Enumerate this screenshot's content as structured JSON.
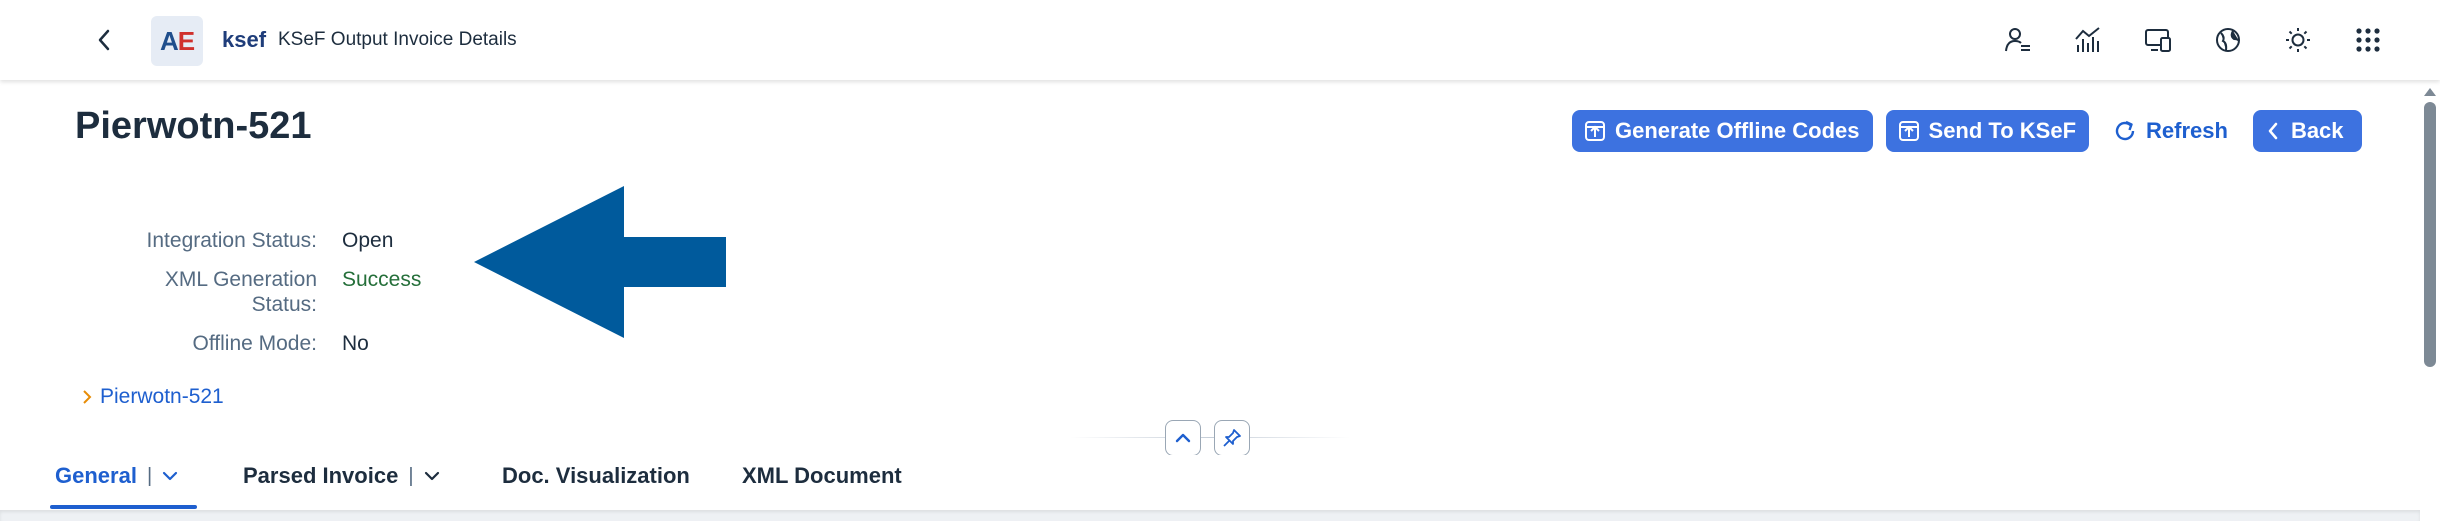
{
  "shell": {
    "logo_a": "A",
    "logo_e": "E",
    "app_name": "ksef",
    "title": "KSeF Output Invoice Details",
    "icons": [
      "user-menu-icon",
      "analytics-icon",
      "device-icon",
      "globe-icon",
      "theme-icon",
      "app-grid-icon"
    ]
  },
  "header": {
    "title": "Pierwotn-521",
    "actions": {
      "generate_offline_codes": "Generate Offline Codes",
      "send_to_ksef": "Send To KSeF",
      "refresh": "Refresh",
      "back": "Back"
    },
    "fields": [
      {
        "label": "Integration Status:",
        "value": "Open"
      },
      {
        "label_line1": "XML Generation",
        "label_line2": "Status:",
        "value": "Success"
      },
      {
        "label": "Offline Mode:",
        "value": "No"
      }
    ],
    "link": "Pierwotn-521"
  },
  "tabs": [
    {
      "label": "General",
      "selected": true,
      "menu": true
    },
    {
      "label": "Parsed Invoice",
      "selected": false,
      "menu": true
    },
    {
      "label": "Doc. Visualization",
      "selected": false
    },
    {
      "label": "XML Document",
      "selected": false
    }
  ],
  "colors": {
    "accent": "#3d72e0",
    "link": "#1e5fcf",
    "success": "#256f3a",
    "arrow": "#005a9c"
  }
}
